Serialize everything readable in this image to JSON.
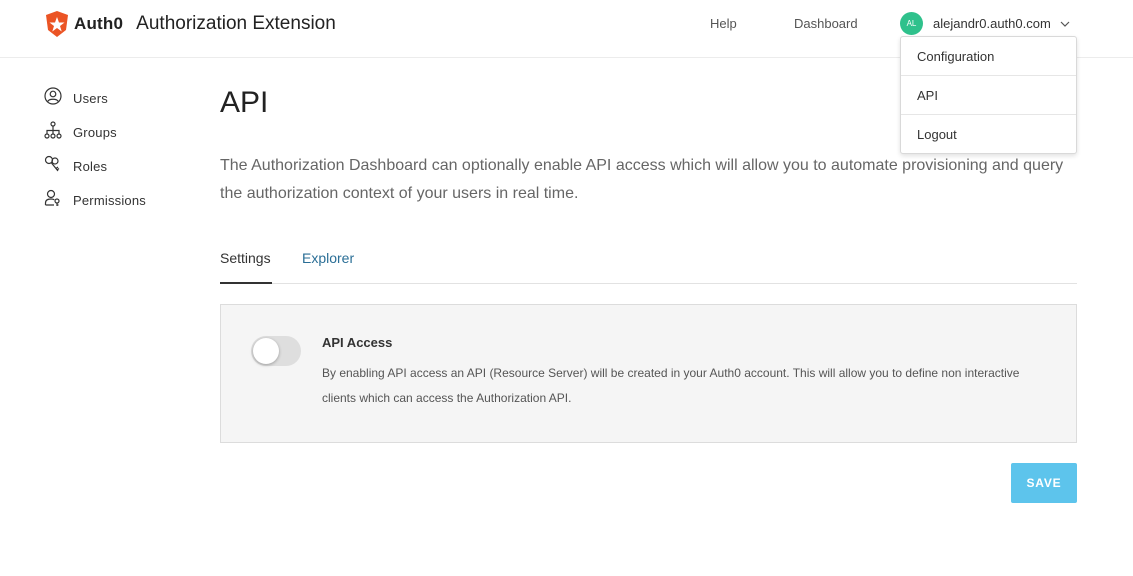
{
  "brand": {
    "logo_word": "Auth0",
    "app_title": "Authorization Extension",
    "logo_color": "#eb5424"
  },
  "header": {
    "help_label": "Help",
    "dashboard_label": "Dashboard",
    "user": {
      "initials": "AL",
      "name": "alejandr0.auth0.com",
      "avatar_color": "#2fc18c"
    }
  },
  "dropdown": {
    "items": [
      {
        "label": "Configuration"
      },
      {
        "label": "API"
      },
      {
        "label": "Logout"
      }
    ]
  },
  "sidebar": {
    "items": [
      {
        "label": "Users",
        "icon": "user-circle-icon"
      },
      {
        "label": "Groups",
        "icon": "hierarchy-icon"
      },
      {
        "label": "Roles",
        "icon": "roles-icon"
      },
      {
        "label": "Permissions",
        "icon": "person-key-icon"
      }
    ]
  },
  "main": {
    "title": "API",
    "description": "The Authorization Dashboard can optionally enable API access which will allow you to automate provisioning and query the authorization context of your users in real time.",
    "tabs": [
      {
        "label": "Settings",
        "active": true
      },
      {
        "label": "Explorer",
        "active": false
      }
    ],
    "api_access": {
      "title": "API Access",
      "text": "By enabling API access an API (Resource Server) will be created in your Auth0 account. This will allow you to define non interactive clients which can access the Authorization API.",
      "enabled": false
    },
    "save_label": "SAVE",
    "accent_color": "#5dc4ec"
  }
}
